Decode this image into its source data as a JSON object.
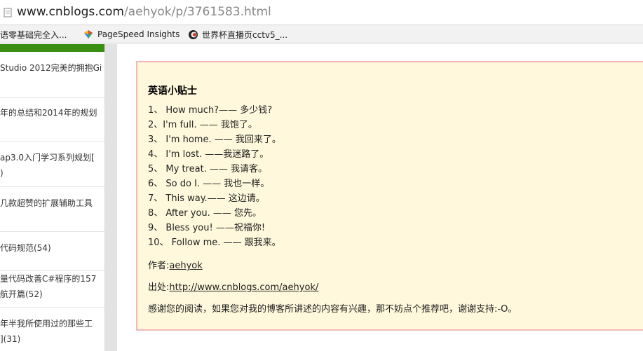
{
  "addressbar": {
    "url_host": "www.cnblogs.com",
    "url_path": "/aehyok/p/3761583.html"
  },
  "bookmarks": [
    {
      "label": "语零基础完全入...",
      "icon": "page-icon"
    },
    {
      "label": "PageSpeed Insights",
      "icon": "pagespeed-icon"
    },
    {
      "label": "世界杯直播页cctv5_...",
      "icon": "cctv-icon"
    }
  ],
  "sidebar": {
    "accent_color": "#3a8e12",
    "items": [
      {
        "line1": "Studio 2012完美的拥抱Gi",
        "line2": ""
      },
      {
        "line1": "年的总结和2014年的规划",
        "line2": ""
      },
      {
        "line1": "ap3.0入门学习系列规划[",
        "line2": ")"
      },
      {
        "line1": "几款超赞的扩展辅助工具",
        "line2": ""
      },
      {
        "line1": "代码规范(54)",
        "line2": ""
      },
      {
        "line1": "量代码改善C#程序的157",
        "line2": "航开篇(52)"
      },
      {
        "line1": "年半我所使用过的那些工",
        "line2": "](31)"
      }
    ]
  },
  "tips": {
    "title": "英语小贴士",
    "items": [
      "1、 How much?—— 多少钱?",
      "2、I'm full. —— 我饱了。",
      "3、 I'm home. —— 我回来了。",
      "4、 I'm lost. ——我迷路了。",
      "5、 My treat. —— 我请客。",
      "6、 So do I. —— 我也一样。",
      "7、 This way.—— 这边请。",
      "8、 After you. —— 您先。",
      "9、 Bless you! ——祝福你!",
      "10、 Follow me. —— 跟我来。"
    ],
    "author_label": "作者:",
    "author_name": "aehyok",
    "source_label": "出处:",
    "source_url": "http://www.cnblogs.com/aehyok/",
    "thanks": "感谢您的阅读，如果您对我的博客所讲述的内容有兴趣，那不妨点个推荐吧，谢谢支持:-O。",
    "background": "#fff8dc",
    "border_color": "#f2b8b8"
  }
}
